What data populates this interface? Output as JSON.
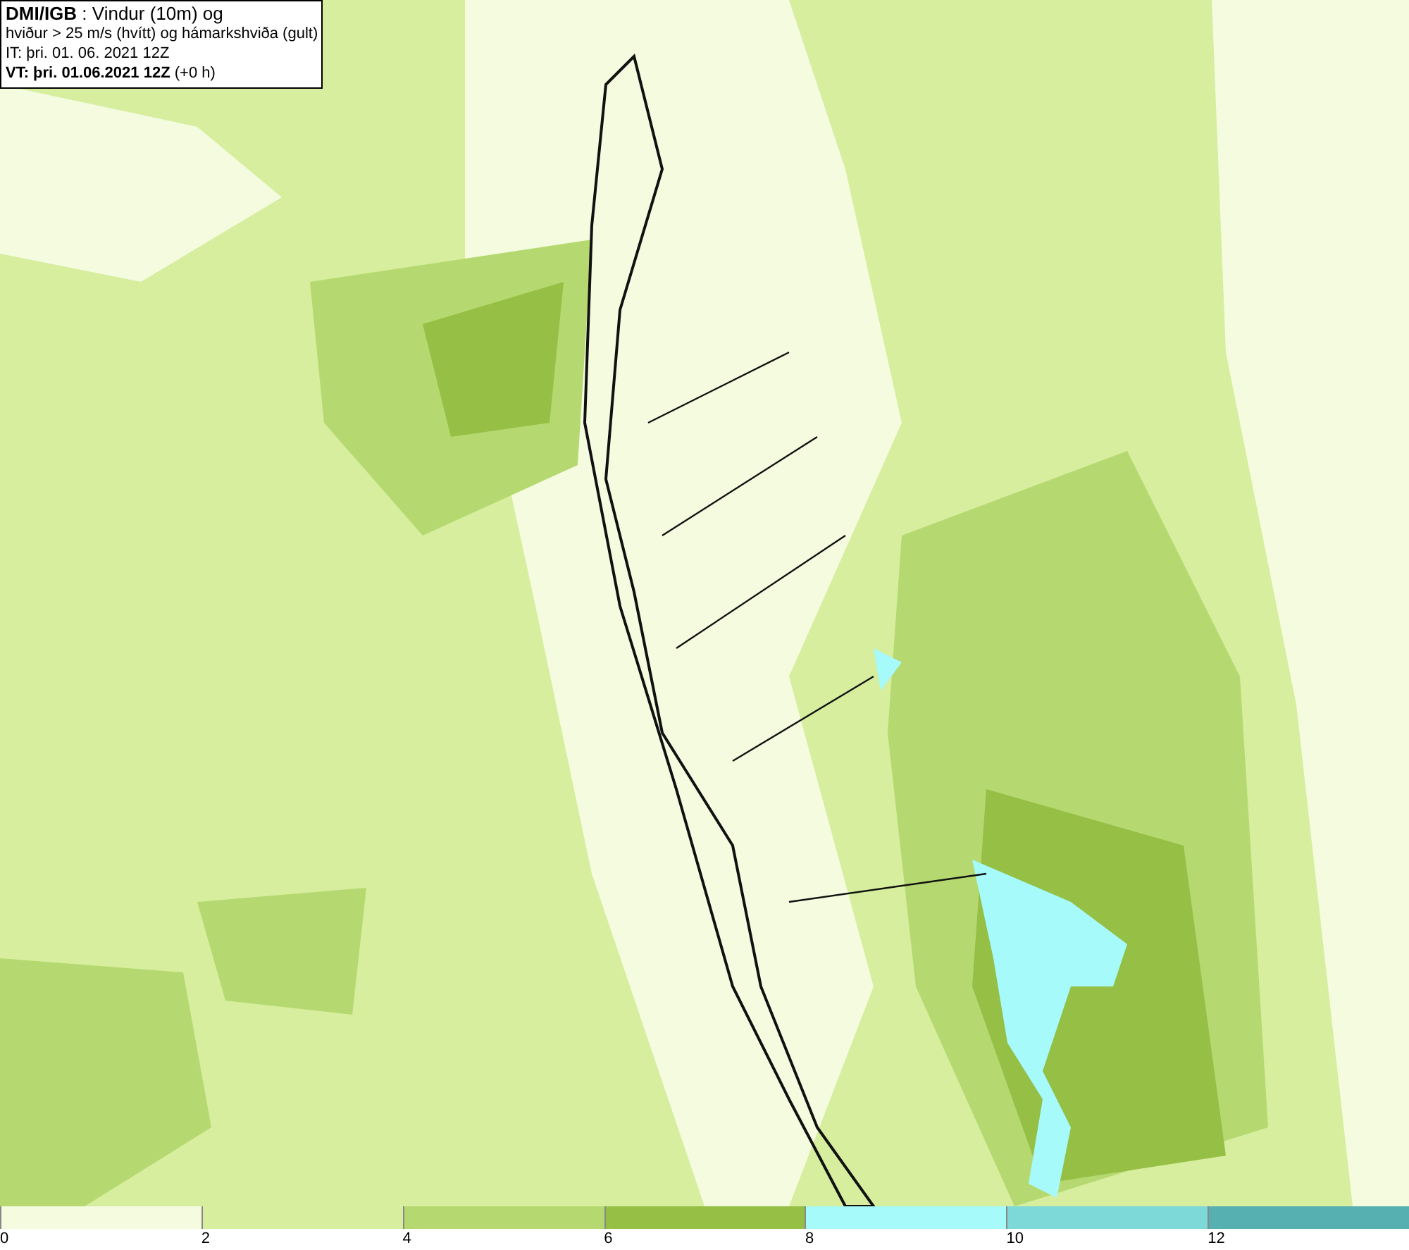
{
  "header": {
    "lines": [
      "**DMI/IGB** : Vindur (10m) og",
      "hviður > 25 m/s (hvítt) og hámarkshviða (gult)",
      "IT: þri. 01. 06. 2021 12Z",
      "**VT: þri. 01.06.2021 12Z** (+0 h)"
    ]
  },
  "legend": {
    "segments": [
      {
        "color": "#f4fbdf",
        "label": "0"
      },
      {
        "color": "#d6ee9e",
        "label": "2"
      },
      {
        "color": "#b5d970",
        "label": "4"
      },
      {
        "color": "#95bf45",
        "label": "6"
      },
      {
        "color": "#a6fafa",
        "label": "8"
      },
      {
        "color": "#7dd8d8",
        "label": "10"
      },
      {
        "color": "#56b0b2",
        "label": "12"
      }
    ]
  }
}
